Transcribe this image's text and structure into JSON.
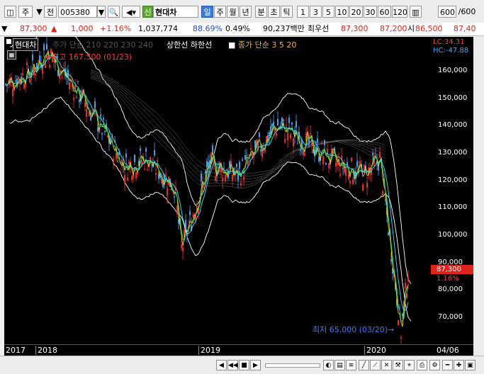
{
  "toolbar": {
    "tab1": "주",
    "tab2": "전",
    "code": "005380",
    "badge": "신",
    "stock_name": "현대차",
    "periods": [
      "일",
      "주",
      "월",
      "년",
      "분",
      "초",
      "틱"
    ],
    "intervals": [
      "1",
      "3",
      "5",
      "10",
      "20",
      "30",
      "60",
      "120"
    ],
    "count": "600",
    "count_total": "/600"
  },
  "quote": {
    "price": "87,300",
    "change": "1,000",
    "change_pct": "+1.16%",
    "volume": "1,037,774",
    "vol_ratio": "88.69%",
    "turnover": "0.49%",
    "amount": "90,237백만",
    "pref_label": "최우선",
    "ask": "87,300",
    "bid": "87,200",
    "open_label": "시",
    "open": "86,500",
    "high_partial": "87,40"
  },
  "chart": {
    "legend_name": "현대차",
    "legend_ma": "주가 단순 210 220 230 240",
    "legend_band": "상한선 하한선",
    "legend_vol": "종가 단순 3 5 20",
    "high_label": "←최고 167,500 (01/23)",
    "low_label": "최저 65,000 (03/20)→",
    "lc": "LC:34.31",
    "hc": "HC:-47.88",
    "last_price": "87,300",
    "last_pct": "1.16%",
    "y_labels": [
      "160,000",
      "150,000",
      "140,000",
      "130,000",
      "120,000",
      "110,000",
      "100,000",
      "90,000",
      "80,000",
      "70,000"
    ],
    "x_labels": [
      "2017",
      "2018",
      "2019",
      "2020",
      "04/06"
    ],
    "colors": {
      "up": "#ff3030",
      "down": "#4ab0ff",
      "band": "#ffffff",
      "price_box": "#e0241c"
    }
  },
  "chart_data": {
    "type": "line",
    "series": [
      {
        "name": "현대차",
        "x": [
          "2017-09",
          "2017-11",
          "2018-01",
          "2018-03",
          "2018-05",
          "2018-07",
          "2018-09",
          "2018-11",
          "2019-01",
          "2019-03",
          "2019-05",
          "2019-07",
          "2019-09",
          "2019-11",
          "2020-01",
          "2020-02",
          "2020-03",
          "2020-04"
        ],
        "values": [
          155000,
          160000,
          167500,
          150000,
          138000,
          125000,
          128000,
          118000,
          95000,
          126000,
          122000,
          140000,
          135000,
          126000,
          122000,
          128000,
          65000,
          87300
        ]
      }
    ],
    "ylim": [
      60000,
      170000
    ]
  }
}
